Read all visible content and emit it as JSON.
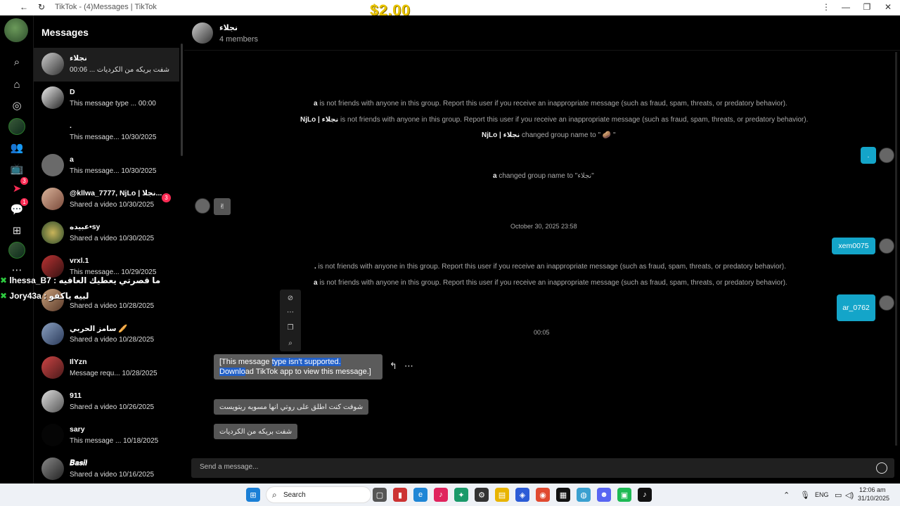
{
  "window": {
    "title": "TikTok - (4)Messages | TikTok",
    "controls": [
      "⋮",
      "—",
      "❐",
      "✕"
    ]
  },
  "overlay": {
    "price": "$2.00"
  },
  "rail": {
    "badges": {
      "inbox": "3",
      "messages": "1"
    }
  },
  "conversations": {
    "title": "Messages",
    "items": [
      {
        "name": "نجلاء",
        "preview": "شفت بريكه من الكرديات ...",
        "time": "00:06"
      },
      {
        "name": "D",
        "preview": "This message type ...",
        "time": "00:00"
      },
      {
        "name": ".",
        "preview": "This message...",
        "time": "10/30/2025"
      },
      {
        "name": "a",
        "preview": "This message...",
        "time": "10/30/2025"
      },
      {
        "name": "@kllwa_7777, NjLo | نجلا...",
        "preview": "Shared a video",
        "time": "10/30/2025",
        "unread": "3"
      },
      {
        "name": "عبيده•sy",
        "preview": "Shared a video",
        "time": "10/30/2025"
      },
      {
        "name": "vrxl.1",
        "preview": "This message...",
        "time": "10/29/2025"
      },
      {
        "name": "",
        "preview": "Shared a video",
        "time": "10/28/2025"
      },
      {
        "name": "سامز الحربي 🥖",
        "preview": "Shared a video",
        "time": "10/28/2025"
      },
      {
        "name": "IlYzn",
        "preview": "Message requ...",
        "time": "10/28/2025"
      },
      {
        "name": "911",
        "preview": "Shared a video",
        "time": "10/26/2025"
      },
      {
        "name": "sary",
        "preview": "This message ...",
        "time": "10/18/2025"
      },
      {
        "name": "𝑩𝒂𝒔𝒊𝒍",
        "preview": "Shared a video",
        "time": "10/16/2025"
      }
    ]
  },
  "stream_chat": [
    {
      "user": "lhessa_B7",
      "msg": "ما قصرتي يعطيك العافيه"
    },
    {
      "user": "Jory43a",
      "msg": "لبيه ياكفو"
    }
  ],
  "chat": {
    "name": "نجلاء",
    "members": "4 members",
    "system_messages": [
      {
        "user": "a",
        "text": " is not friends with anyone in this group. Report this user if you receive an inappropriate message (such as fraud, spam, threats, or predatory behavior)."
      },
      {
        "user": "NjLo | نجلاء",
        "text": " is not friends with anyone in this group. Report this user if you receive an inappropriate message (such as fraud, spam, threats, or predatory behavior)."
      },
      {
        "user": "NjLo | نجلاء",
        "text": " changed group name to \" 🥔 \""
      },
      {
        "user": "a",
        "text": " changed group name to \"نجلاء\""
      },
      {
        "user": ".",
        "text": " is not friends with anyone in this group. Report this user if you receive an inappropriate message (such as fraud, spam, threats, or predatory behavior)."
      },
      {
        "user": "a",
        "text": " is not friends with anyone in this group. Report this user if you receive an inappropriate message (such as fraud, spam, threats, or predatory behavior)."
      }
    ],
    "timestamps": [
      "October 30, 2025 23:58",
      "00:05"
    ],
    "outgoing": [
      ".",
      "xem0075",
      "ar_0762"
    ],
    "incoming_emoji": "✌",
    "unsupported": {
      "highlighted_1": "[This message ",
      "highlighted_2": "type isn't supported.",
      "line2_hl": "Downlo",
      "line2_rest": "ad TikTok app to view this message.]"
    },
    "incoming_texts": [
      "شوفت كنت اطلق على روتي انها مسويه ريتويست",
      "شفت بريكه من الكرديات"
    ],
    "composer_placeholder": "Send a message..."
  },
  "taskbar": {
    "search": "Search",
    "lang": "ENG",
    "time": "12:06 am",
    "date": "31/10/2025"
  }
}
